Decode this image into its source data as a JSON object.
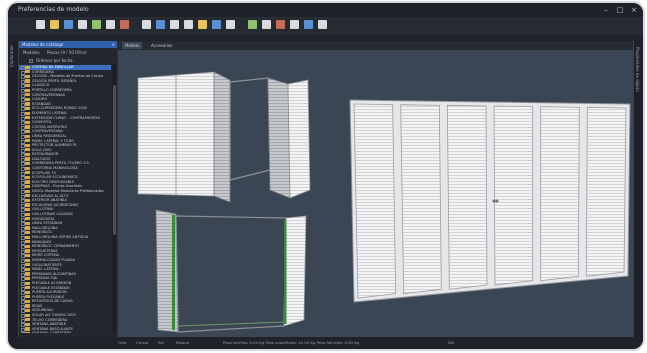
{
  "window": {
    "title": "Preferencias de modelo",
    "controls": [
      "–",
      "□",
      "×"
    ]
  },
  "toolbar": {
    "icons": [
      "new-icon",
      "open-icon",
      "save-icon",
      "print-icon",
      "undo-icon",
      "redo-icon",
      "copy-icon",
      "paste-icon",
      "cut-icon",
      "delete-icon",
      "zoom-icon",
      "rotate-icon",
      "grid-icon",
      "measure-icon",
      "layers-icon",
      "settings-icon",
      "render-icon",
      "camera-icon",
      "info-icon",
      "help-icon"
    ]
  },
  "left_rail": {
    "label": "Explorador"
  },
  "right_rail": {
    "label": "Propiedades de objeto"
  },
  "panel": {
    "header": "Modelos de catálogo",
    "close": "×",
    "tabs": [
      "Modelos",
      "Piezas (9 / 50 Filtro)"
    ],
    "search_label": "Ordenar por fecha",
    "tree": [
      "CORTINA DE ENROLLAR",
      "CORREDERA",
      "CELOSÍA - Modelos de Puertas de Cocina",
      "CELOSÍA PERFIL ESPAÑOL",
      "CLASSICO",
      "PORTILLO CORREDERA",
      "CONTRAVENTANAS",
      "CUADRO",
      "ESTANDAR",
      "ECO-CORREDERA RONDO 2000",
      "ELEMENTO LATERAL",
      "EXTENSIÓN CLIMAT... CONTRAPUERTAS",
      "COSMOPOL",
      "COSTAS ANTIRUTAS",
      "CONTRAVENTANA",
      "LÍNEA RESIDENCIAL",
      "PANEL LATERAL Y TODO",
      "PROTECTOR ALUMINIO PL",
      "SOLA 2000",
      "RESTAURADOR",
      "DIALOGOS",
      "CORREDERA PERFIL TOLERO 3.5",
      "CONTORNA MARAVILLOSA",
      "ECOPLUSE 70",
      "ECOSOLAR ECOLINEMATIC",
      "ELECTRO DESPLEGABLE",
      "DIVERSAS - Puerta Acordeón",
      "DEVOL Modelos Modulares Prefabricados",
      "EXCLUSIVAS AL ALTO",
      "EXTERIOR ABATIBLE",
      "ESCALERAS ACORDEONES",
      "GUILLOTINA",
      "GUILLOTINAS LACADAS",
      "HORIZONTAL",
      "LÍNEA ESTÁNDAR",
      "MALLORQUINA",
      "MONOBLOC",
      "MALLORQUINA SERIES ANTIGUA",
      "MANUALES",
      "MONOBLOC CERRAMIENTO",
      "MOSQUITERAS",
      "MURO CORTINA",
      "NORMALIZADAS PLANAS",
      "OSCILOBATIENTE",
      "PANEL LATERAL",
      "PERSIANAS ALICANTINAS",
      "PERSIANA FIJA",
      "PLEGABLE ACORDEÓN",
      "PLEGABLE ESTÁNDAR",
      "PUERTA ACORDEÓN",
      "PUERTA PLEGABLE",
      "REFUERZOS DE CARGA",
      "REJAS",
      "SEGURIDAD",
      "SOLAR ALT GUBIOS 2000",
      "TECHO CORREDERA",
      "VENTANA ABATIBLE",
      "VENTANA BASCULANTE",
      "VENTANA CORREDERA",
      "VENTANA FIJA",
      "VENTANA PLEGABLE",
      "VIDRIERA",
      "ZÓCALOS"
    ],
    "selected_index": 0
  },
  "viewport": {
    "tabs": [
      "Modelo",
      "Accesorios"
    ],
    "active_tab": 0,
    "background": "#3b4654"
  },
  "status": {
    "items": [
      "Orto",
      "Cursor",
      "Rej",
      "Bloque",
      "Peso perfiles: 0.00 Kg   Peso superficies: 41.00 Kg   Peso herrajes: 0.00 Kg",
      "INS"
    ]
  },
  "colors": {
    "accent": "#2f5fa8",
    "folder": "#e0a93a",
    "frame_gray": "#c9ccd1",
    "slat_white": "#f2f2f2",
    "hinge_green": "#3a8a3a"
  }
}
